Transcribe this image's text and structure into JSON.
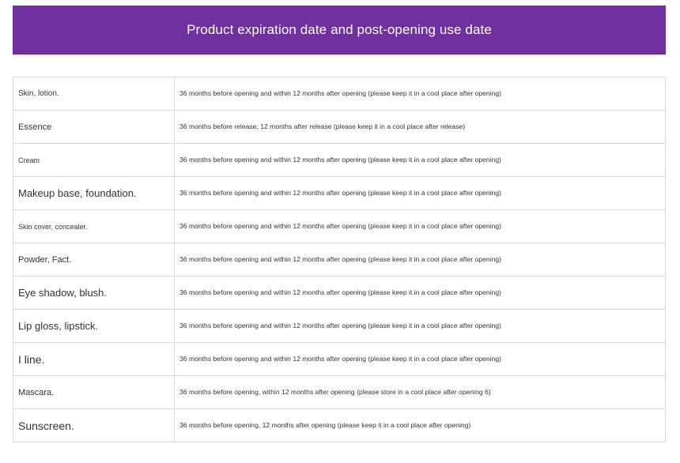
{
  "header": {
    "title": "Product expiration date and post-opening use date",
    "background": "#7030a0"
  },
  "rows": [
    {
      "category": "Skin, lotion.",
      "description": "36 months before opening and within 12 months after opening (please keep it in a cool place after opening)"
    },
    {
      "category": "Essence",
      "description": "36 months before release, 12 months after release (please keep it in a cool place after release)"
    },
    {
      "category": "Cream",
      "description": "36 months before opening and within 12 months after opening (please keep it in a cool place after opening)"
    },
    {
      "category": "Makeup base, foundation.",
      "description": "36 months before opening and within 12 months after opening (please keep it in a cool place after opening)"
    },
    {
      "category": "Skin cover, concealer.",
      "description": "36 months before opening and within 12 months after opening (please keep it in a cool place after opening)"
    },
    {
      "category": "Powder, Fact.",
      "description": "36 months before opening and within 12 months after opening (please keep it in a cool place after opening)"
    },
    {
      "category": "Eye shadow, blush.",
      "description": "36 months before opening and within 12 months after opening (please keep it in a cool place after opening)"
    },
    {
      "category": "Lip gloss, lipstick.",
      "description": "36 months before opening and within 12 months after opening (please keep it in a cool place after opening)"
    },
    {
      "category": "I line.",
      "description": "36 months before opening and within 12 months after opening (please keep it in a cool place after opening)"
    },
    {
      "category": "Mascara.",
      "description": "36 months before opening, within 12 months after opening (please store in a cool place after opening 6)"
    },
    {
      "category": "Sunscreen.",
      "description": "36 months before opening, 12 months after opening (please keep it in a cool place after opening)"
    }
  ]
}
